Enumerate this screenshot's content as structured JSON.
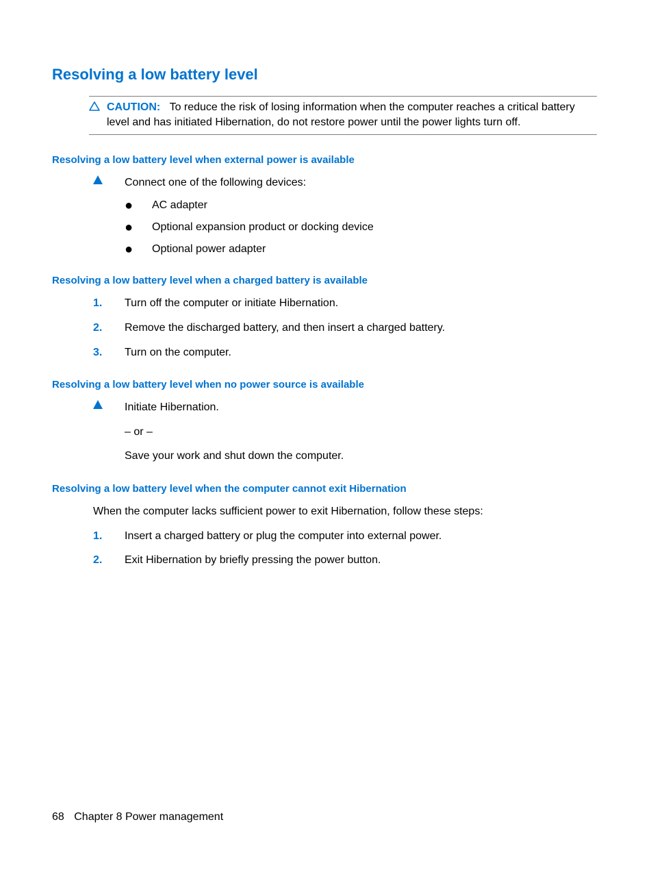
{
  "title": "Resolving a low battery level",
  "caution": {
    "label": "CAUTION:",
    "text": "To reduce the risk of losing information when the computer reaches a critical battery level and has initiated Hibernation, do not restore power until the power lights turn off."
  },
  "sec1": {
    "heading": "Resolving a low battery level when external power is available",
    "lead": "Connect one of the following devices:",
    "items": {
      "0": "AC adapter",
      "1": "Optional expansion product or docking device",
      "2": "Optional power adapter"
    }
  },
  "sec2": {
    "heading": "Resolving a low battery level when a charged battery is available",
    "steps": {
      "0": {
        "num": "1.",
        "text": "Turn off the computer or initiate Hibernation."
      },
      "1": {
        "num": "2.",
        "text": "Remove the discharged battery, and then insert a charged battery."
      },
      "2": {
        "num": "3.",
        "text": "Turn on the computer."
      }
    }
  },
  "sec3": {
    "heading": "Resolving a low battery level when no power source is available",
    "line1": "Initiate Hibernation.",
    "line2": "– or –",
    "line3": "Save your work and shut down the computer."
  },
  "sec4": {
    "heading": "Resolving a low battery level when the computer cannot exit Hibernation",
    "intro": "When the computer lacks sufficient power to exit Hibernation, follow these steps:",
    "steps": {
      "0": {
        "num": "1.",
        "text": "Insert a charged battery or plug the computer into external power."
      },
      "1": {
        "num": "2.",
        "text": "Exit Hibernation by briefly pressing the power button."
      }
    }
  },
  "footer": {
    "page": "68",
    "chapter": "Chapter 8   Power management"
  }
}
